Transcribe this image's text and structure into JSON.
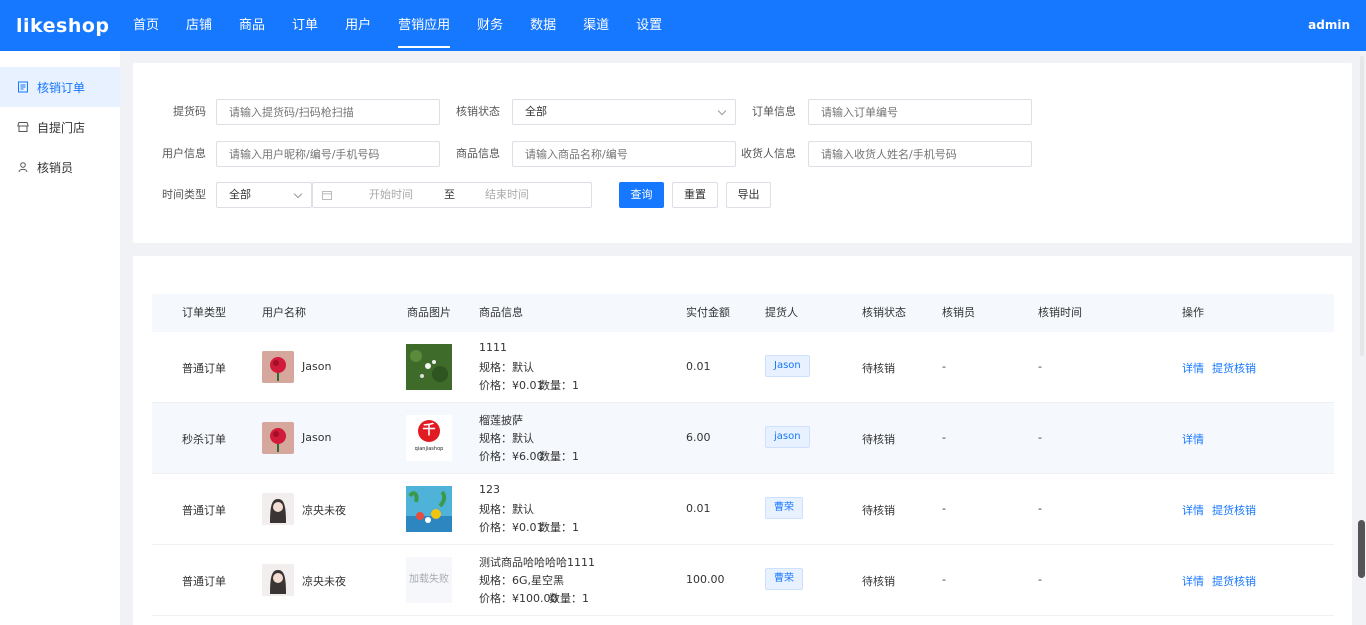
{
  "app": {
    "logo": "likeshop",
    "user": "admin"
  },
  "nav": [
    {
      "label": "首页",
      "active": false
    },
    {
      "label": "店铺",
      "active": false
    },
    {
      "label": "商品",
      "active": false
    },
    {
      "label": "订单",
      "active": false
    },
    {
      "label": "用户",
      "active": false
    },
    {
      "label": "营销应用",
      "active": true
    },
    {
      "label": "财务",
      "active": false
    },
    {
      "label": "数据",
      "active": false
    },
    {
      "label": "渠道",
      "active": false
    },
    {
      "label": "设置",
      "active": false
    }
  ],
  "sidebar": [
    {
      "label": "核销订单",
      "icon": "receipt-icon",
      "active": true
    },
    {
      "label": "自提门店",
      "icon": "store-icon",
      "active": false
    },
    {
      "label": "核销员",
      "icon": "user-icon",
      "active": false
    }
  ],
  "filters": {
    "pickup_code": {
      "label": "提货码",
      "placeholder": "请输入提货码/扫码枪扫描"
    },
    "verify_status": {
      "label": "核销状态",
      "value": "全部"
    },
    "order_info": {
      "label": "订单信息",
      "placeholder": "请输入订单编号"
    },
    "user_info": {
      "label": "用户信息",
      "placeholder": "请输入用户昵称/编号/手机号码"
    },
    "goods_info": {
      "label": "商品信息",
      "placeholder": "请输入商品名称/编号"
    },
    "receiver_info": {
      "label": "收货人信息",
      "placeholder": "请输入收货人姓名/手机号码"
    },
    "time_type": {
      "label": "时间类型",
      "value": "全部"
    },
    "start_time": "开始时间",
    "to": "至",
    "end_time": "结束时间",
    "query_button": "查询",
    "reset_button": "重置",
    "export_button": "导出"
  },
  "table": {
    "headers": [
      "订单类型",
      "用户名称",
      "商品图片",
      "商品信息",
      "实付金额",
      "提货人",
      "核销状态",
      "核销员",
      "核销时间",
      "操作"
    ],
    "rows": [
      {
        "order_type": "普通订单",
        "user": "Jason",
        "goods_name": "1111",
        "spec": "规格：默认",
        "price": "价格：¥0.01",
        "qty": "数量：1",
        "paid": "0.01",
        "picker": "Jason",
        "status": "待核销",
        "verifier": "-",
        "verify_time": "-",
        "actions": [
          "详情",
          "提货核销"
        ]
      },
      {
        "order_type": "秒杀订单",
        "user": "Jason",
        "goods_name": "榴莲披萨",
        "spec": "规格：默认",
        "price": "价格：¥6.00",
        "qty": "数量：1",
        "paid": "6.00",
        "picker": "jason",
        "status": "待核销",
        "verifier": "-",
        "verify_time": "-",
        "actions": [
          "详情"
        ],
        "goods_logo_text": "千",
        "goods_logo_sub": "qianjiashop"
      },
      {
        "order_type": "普通订单",
        "user": "凉央未夜",
        "goods_name": "123",
        "spec": "规格：默认",
        "price": "价格：¥0.01",
        "qty": "数量：1",
        "paid": "0.01",
        "picker": "曹荣",
        "status": "待核销",
        "verifier": "-",
        "verify_time": "-",
        "actions": [
          "详情",
          "提货核销"
        ]
      },
      {
        "order_type": "普通订单",
        "user": "凉央未夜",
        "goods_name": "测试商品哈哈哈哈1111",
        "spec": "规格：6G,星空黑",
        "price": "价格：¥100.00",
        "qty": "数量：1",
        "paid": "100.00",
        "picker": "曹荣",
        "status": "待核销",
        "verifier": "-",
        "verify_time": "-",
        "actions": [
          "详情",
          "提货核销"
        ],
        "image_failed_text": "加载失败"
      }
    ]
  }
}
